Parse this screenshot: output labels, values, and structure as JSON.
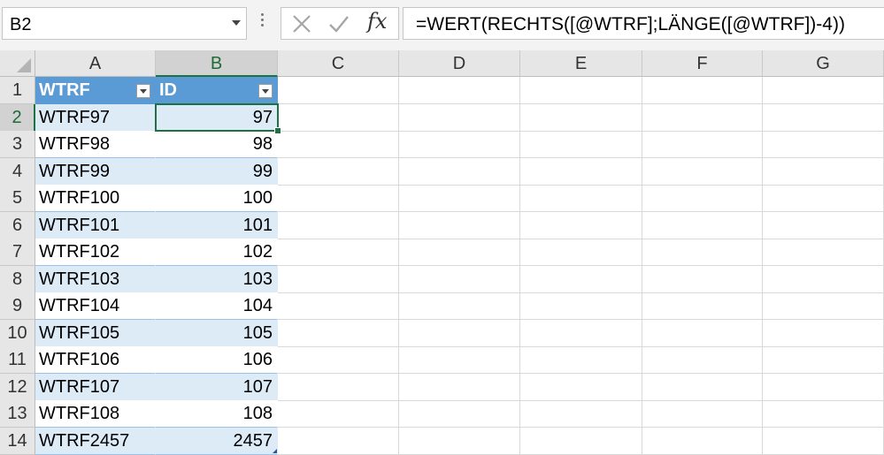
{
  "namebox": {
    "value": "B2"
  },
  "formula_bar": {
    "fx_label": "fx",
    "formula": "=WERT(RECHTS([@WTRF];LÄNGE([@WTRF])-4))"
  },
  "columns": [
    "A",
    "B",
    "C",
    "D",
    "E",
    "F",
    "G"
  ],
  "table": {
    "headers": [
      "WTRF",
      "ID"
    ],
    "rows": [
      [
        "WTRF97",
        "97"
      ],
      [
        "WTRF98",
        "98"
      ],
      [
        "WTRF99",
        "99"
      ],
      [
        "WTRF100",
        "100"
      ],
      [
        "WTRF101",
        "101"
      ],
      [
        "WTRF102",
        "102"
      ],
      [
        "WTRF103",
        "103"
      ],
      [
        "WTRF104",
        "104"
      ],
      [
        "WTRF105",
        "105"
      ],
      [
        "WTRF106",
        "106"
      ],
      [
        "WTRF107",
        "107"
      ],
      [
        "WTRF108",
        "108"
      ],
      [
        "WTRF2457",
        "2457"
      ]
    ]
  },
  "row_numbers": [
    "1",
    "2",
    "3",
    "4",
    "5",
    "6",
    "7",
    "8",
    "9",
    "10",
    "11",
    "12",
    "13",
    "14"
  ],
  "selected_cell": "B2",
  "colors": {
    "table_header": "#5b9bd5",
    "band": "#ddebf7",
    "selection": "#1e7145"
  },
  "icons": [
    "dropdown-arrow-icon",
    "more-options-icon",
    "cancel-icon",
    "enter-icon",
    "insert-function-icon",
    "filter-dropdown-icon"
  ]
}
